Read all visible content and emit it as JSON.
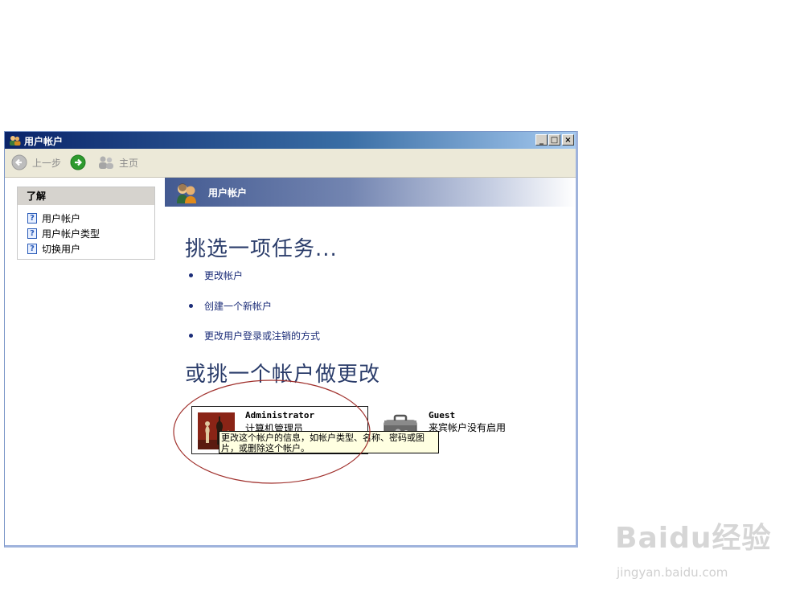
{
  "window": {
    "title": "用户帐户",
    "minimize": "_",
    "maximize": "□",
    "close": "×"
  },
  "toolbar": {
    "back_label": "上一步",
    "home_label": "主页"
  },
  "sidebar": {
    "title": "了解",
    "items": [
      {
        "label": "用户帐户"
      },
      {
        "label": "用户帐户类型"
      },
      {
        "label": "切换用户"
      }
    ]
  },
  "main": {
    "banner_title": "用户帐户",
    "pick_task_heading": "挑选一项任务...",
    "tasks": [
      {
        "label": "更改帐户"
      },
      {
        "label": "创建一个新帐户"
      },
      {
        "label": "更改用户登录或注销的方式"
      }
    ],
    "pick_account_heading": "或挑一个帐户做更改",
    "accounts": [
      {
        "name": "Administrator",
        "description": "计算机管理员"
      },
      {
        "name": "Guest",
        "description": "来宾帐户没有启用"
      }
    ],
    "tooltip_line1": "更改这个帐户的信息，如帐户类型、名称、密码或图",
    "tooltip_line2": "片，或删除这个帐户。"
  },
  "watermark": {
    "text": "Baidu经验",
    "url_text": "jingyan.baidu.com"
  },
  "colors": {
    "titlebar": "#0a246a",
    "banner": "#435a91",
    "link": "#1b2c78",
    "annotation": "#a0302c"
  }
}
